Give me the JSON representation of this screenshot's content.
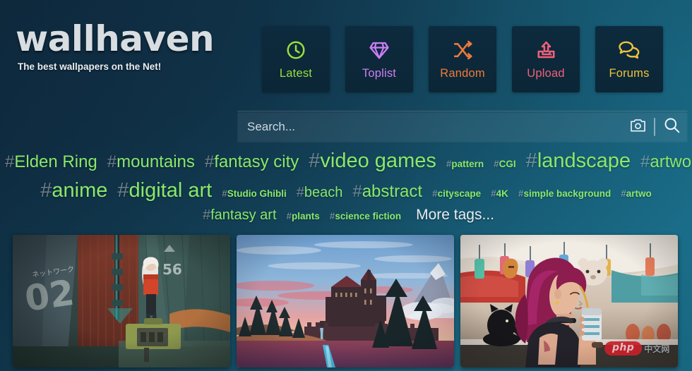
{
  "site": {
    "logo_text": "wallhaven",
    "tagline": "The best wallpapers on the Net!"
  },
  "nav": {
    "items": [
      {
        "label": "Latest",
        "icon": "clock-icon",
        "color": "#9ade3c"
      },
      {
        "label": "Toplist",
        "icon": "diamond-icon",
        "color": "#cd7ef5"
      },
      {
        "label": "Random",
        "icon": "shuffle-icon",
        "color": "#f2793a"
      },
      {
        "label": "Upload",
        "icon": "upload-icon",
        "color": "#f0607a"
      },
      {
        "label": "Forums",
        "icon": "speech-bubbles-icon",
        "color": "#efc23a"
      }
    ]
  },
  "search": {
    "placeholder": "Search...",
    "value": "",
    "camera_icon": "camera-icon",
    "submit_icon": "search-icon"
  },
  "tags": {
    "more_label": "More tags...",
    "accent_color": "#8ae86a",
    "rows": [
      [
        {
          "label": "Elden Ring",
          "size": "lg"
        },
        {
          "label": "mountains",
          "size": "lg"
        },
        {
          "label": "fantasy city",
          "size": "lg"
        },
        {
          "label": "video games",
          "size": "xl"
        },
        {
          "label": "pattern",
          "size": "sm"
        },
        {
          "label": "CGI",
          "size": "sm"
        },
        {
          "label": "landscape",
          "size": "xl"
        },
        {
          "label": "artwo",
          "size": "lg"
        }
      ],
      [
        {
          "label": "anime",
          "size": "xl"
        },
        {
          "label": "digital art",
          "size": "xl"
        },
        {
          "label": "Studio Ghibli",
          "size": "sm"
        },
        {
          "label": "beach",
          "size": "md"
        },
        {
          "label": "abstract",
          "size": "lg"
        },
        {
          "label": "cityscape",
          "size": "sm"
        },
        {
          "label": "4K",
          "size": "sm"
        },
        {
          "label": "simple background",
          "size": "sm"
        },
        {
          "label": "artwo",
          "size": "sm"
        }
      ],
      [
        {
          "label": "fantasy art",
          "size": "md"
        },
        {
          "label": "plants",
          "size": "sm"
        },
        {
          "label": "science fiction",
          "size": "sm"
        }
      ]
    ]
  },
  "thumbnails": [
    {
      "name": "cyberpunk-alley-wallpaper",
      "alt_text": "Anime girl with white hair in a cyberpunk industrial alley",
      "overlay_text_1": "ネットワーク",
      "overlay_text_2": "02",
      "overlay_text_3": "56",
      "watermark": null
    },
    {
      "name": "castle-sunset-wallpaper",
      "alt_text": "Fantasy castle on a hill at sunset with pines, river and snowy mountain",
      "watermark": null
    },
    {
      "name": "market-girl-cat-wallpaper",
      "alt_text": "Anime girl with magenta hair drinking a beverage beside a black cat at a market",
      "watermark": {
        "pill": "php",
        "text": "中文网"
      }
    }
  ]
}
